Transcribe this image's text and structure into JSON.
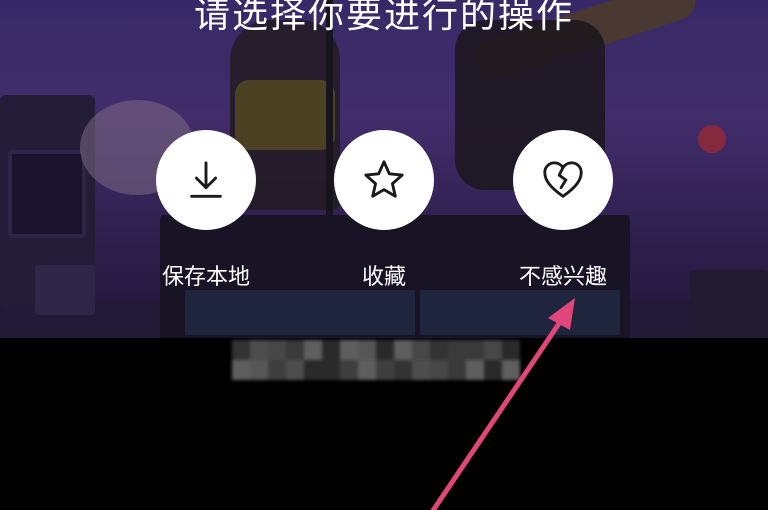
{
  "prompt": {
    "title": "请选择你要进行的操作"
  },
  "actions": [
    {
      "id": "save",
      "label": "保存本地",
      "icon": "download-icon"
    },
    {
      "id": "favorite",
      "label": "收藏",
      "icon": "star-icon"
    },
    {
      "id": "not_interested",
      "label": "不感兴趣",
      "icon": "broken-heart-icon"
    }
  ],
  "colors": {
    "overlay_text": "#ffffff",
    "action_circle": "#ffffff",
    "icon_stroke": "#1a1a1a",
    "annotation_arrow": "#e0457b",
    "bottom_area": "#000000"
  }
}
